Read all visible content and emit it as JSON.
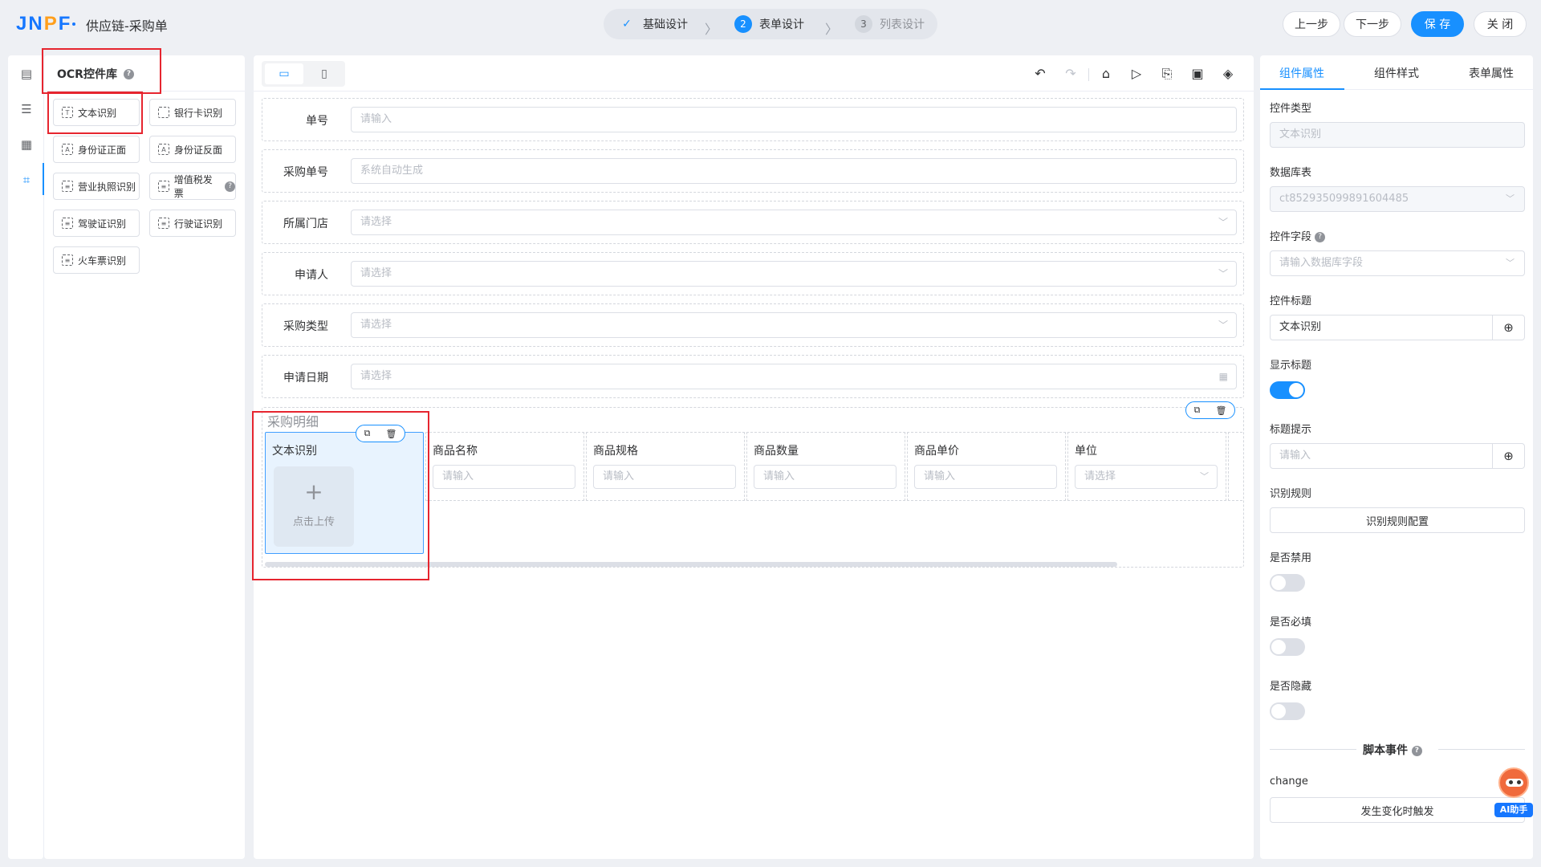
{
  "header": {
    "logo_left": "JN",
    "logo_mid": "P",
    "logo_right": "F",
    "title": "供应链-采购单",
    "steps": [
      {
        "num": "✓",
        "label": "基础设计"
      },
      {
        "num": "2",
        "label": "表单设计"
      },
      {
        "num": "3",
        "label": "列表设计"
      }
    ],
    "buttons": {
      "prev": "上一步",
      "next": "下一步",
      "save": "保 存",
      "close": "关 闭"
    }
  },
  "ocr_panel": {
    "title": "OCR控件库",
    "items": [
      "文本识别",
      "银行卡识别",
      "身份证正面",
      "身份证反面",
      "营业执照识别",
      "增值税发票",
      "驾驶证识别",
      "行驶证识别",
      "火车票识别"
    ]
  },
  "form": {
    "fields": [
      {
        "label": "单号",
        "placeholder": "请输入"
      },
      {
        "label": "采购单号",
        "placeholder": "系统自动生成"
      },
      {
        "label": "所属门店",
        "placeholder": "请选择"
      },
      {
        "label": "申请人",
        "placeholder": "请选择"
      },
      {
        "label": "采购类型",
        "placeholder": "请选择"
      },
      {
        "label": "申请日期",
        "placeholder": "请选择"
      }
    ],
    "subtable": {
      "title": "采购明细",
      "ocr_column": {
        "header": "文本识别",
        "upload_label": "点击上传"
      },
      "columns": [
        {
          "header": "商品名称",
          "placeholder": "请输入"
        },
        {
          "header": "商品规格",
          "placeholder": "请输入"
        },
        {
          "header": "商品数量",
          "placeholder": "请输入"
        },
        {
          "header": "商品单价",
          "placeholder": "请输入"
        },
        {
          "header": "单位",
          "placeholder": "请选择"
        }
      ]
    }
  },
  "props": {
    "tabs": [
      "组件属性",
      "组件样式",
      "表单属性"
    ],
    "control_type_label": "控件类型",
    "control_type_value": "文本识别",
    "db_table_label": "数据库表",
    "db_table_value": "ct852935099891604485",
    "field_label": "控件字段",
    "field_placeholder": "请输入数据库字段",
    "title_label": "控件标题",
    "title_value": "文本识别",
    "show_title_label": "显示标题",
    "title_tip_label": "标题提示",
    "title_tip_placeholder": "请输入",
    "rule_label": "识别规则",
    "rule_button": "识别规则配置",
    "disabled_label": "是否禁用",
    "required_label": "是否必填",
    "hidden_label": "是否隐藏",
    "script_events_label": "脚本事件",
    "event_name": "change",
    "event_button": "发生变化时触发",
    "ai_label": "AI助手"
  },
  "colors": {
    "primary": "#1890ff",
    "highlight": "#e6252f"
  }
}
